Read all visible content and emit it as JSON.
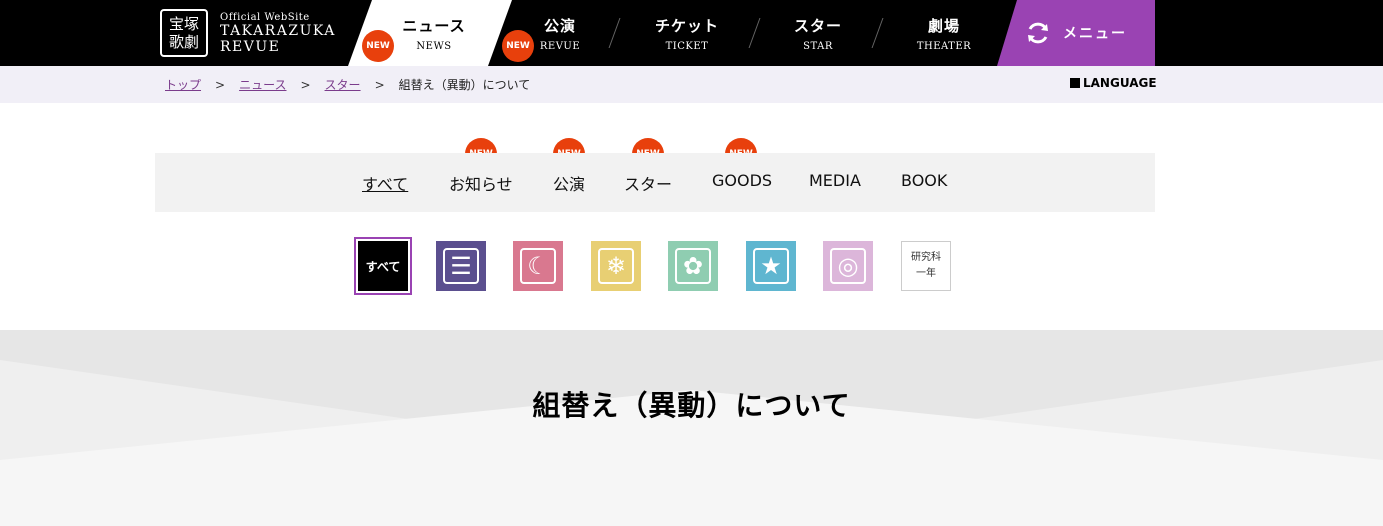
{
  "header": {
    "logo": {
      "mark_top": "宝塚",
      "mark_bottom": "歌劇",
      "subtitle": "Official WebSite",
      "title_line1": "TAKARAZUKA",
      "title_line2": "REVUE"
    },
    "nav": [
      {
        "jp": "ニュース",
        "en": "NEWS",
        "badge": "NEW",
        "active": true
      },
      {
        "jp": "公演",
        "en": "REVUE",
        "badge": "NEW"
      },
      {
        "jp": "チケット",
        "en": "TICKET"
      },
      {
        "jp": "スター",
        "en": "STAR"
      },
      {
        "jp": "劇場",
        "en": "THEATER"
      }
    ],
    "menu_label": "メニュー",
    "accent_color": "#9a43b3",
    "badge_color": "#e8400c"
  },
  "breadcrumb": {
    "items": [
      "トップ",
      "ニュース",
      "スター"
    ],
    "separator": ">",
    "current": "組替え（異動）について",
    "language": "LANGUAGE"
  },
  "categories": [
    {
      "label": "すべて",
      "active": true
    },
    {
      "label": "お知らせ",
      "badge": "NEW"
    },
    {
      "label": "公演",
      "badge": "NEW"
    },
    {
      "label": "スター",
      "badge": "NEW"
    },
    {
      "label": "GOODS",
      "badge": "NEW"
    },
    {
      "label": "MEDIA"
    },
    {
      "label": "BOOK"
    }
  ],
  "troupes": {
    "all_label": "すべて",
    "items": [
      {
        "icon": "hana-troupe-icon",
        "color": "#5b4f8f"
      },
      {
        "icon": "tsuki-troupe-icon",
        "color": "#d9788f"
      },
      {
        "icon": "yuki-troupe-icon",
        "color": "#e8cf73"
      },
      {
        "icon": "hoshi-troupe-icon",
        "color": "#8fcdb1"
      },
      {
        "icon": "sora-troupe-icon",
        "color": "#5fb6d0"
      },
      {
        "icon": "senka-icon",
        "color": "#dcb6da"
      }
    ],
    "kenkyu_line1": "研究科",
    "kenkyu_line2": "一年"
  },
  "article": {
    "title": "組替え（異動）について"
  }
}
